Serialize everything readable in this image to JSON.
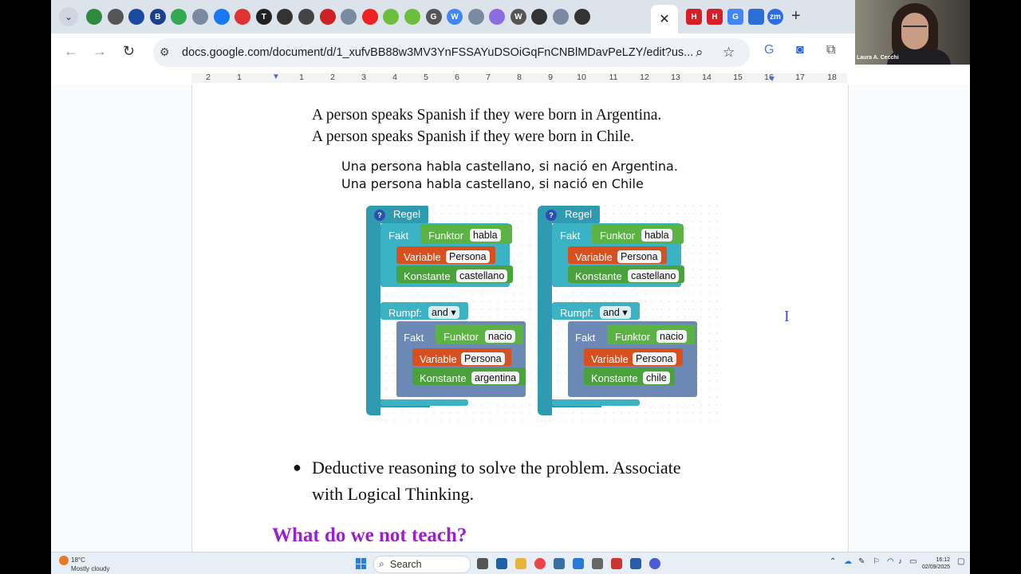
{
  "browser": {
    "tab_strip": {
      "dropdown_icon": "chevron-down-icon",
      "favicon_badges": [
        "",
        "",
        "",
        "B",
        "",
        "",
        "",
        "",
        "T",
        "",
        "",
        "",
        "",
        "",
        "",
        "",
        "G",
        "W",
        "",
        "",
        "W",
        "",
        "",
        ""
      ],
      "active_tab_close": "✕",
      "right_badges": [
        "H",
        "H",
        "G",
        "",
        "zm"
      ],
      "new_tab": "+"
    },
    "toolbar": {
      "back": "←",
      "forward": "→",
      "reload": "↻",
      "url": "docs.google.com/document/d/1_xufvBB88w3MV3YnFSSAYuDSOiGqFnCNBlMDavPeLZY/edit?us..."
    }
  },
  "webcam": {
    "name": "Laura A. Cecchi"
  },
  "ruler": {
    "numbers": [
      "2",
      "1",
      "1",
      "2",
      "3",
      "4",
      "5",
      "6",
      "7",
      "8",
      "9",
      "10",
      "11",
      "12",
      "13",
      "14",
      "15",
      "16",
      "17",
      "18"
    ]
  },
  "doc": {
    "english_lines": [
      "A person speaks Spanish if they were born in Argentina.",
      "A person speaks Spanish if they were born in Chile."
    ],
    "spanish_lines": [
      "Una persona habla castellano, si nació en Argentina.",
      "Una persona habla castellano, si nació en Chile"
    ],
    "bullet_symbol": "●",
    "bullet_lines": [
      "Deductive reasoning to solve the problem. Associate",
      "with Logical Thinking."
    ],
    "heading": "What do we not teach?"
  },
  "blocks": [
    {
      "rule": "Regel",
      "help": "?",
      "head_fakt": "Fakt",
      "head_funktor": "Funktor",
      "head_funktor_value": "habla",
      "variable": "Variable",
      "variable_value": "Persona",
      "konstante": "Konstante",
      "konstante_value": "castellano",
      "rumpf": "Rumpf:",
      "operator": "and",
      "body_fakt": "Fakt",
      "body_funktor": "Funktor",
      "body_funktor_value": "nacio",
      "body_variable": "Variable",
      "body_variable_value": "Persona",
      "body_konstante": "Konstante",
      "body_konstante_value": "argentina"
    },
    {
      "rule": "Regel",
      "help": "?",
      "head_fakt": "Fakt",
      "head_funktor": "Funktor",
      "head_funktor_value": "habla",
      "variable": "Variable",
      "variable_value": "Persona",
      "konstante": "Konstante",
      "konstante_value": "castellano",
      "rumpf": "Rumpf:",
      "operator": "and",
      "body_fakt": "Fakt",
      "body_funktor": "Funktor",
      "body_funktor_value": "nacio",
      "body_variable": "Variable",
      "body_variable_value": "Persona",
      "body_konstante": "Konstante",
      "body_konstante_value": "chile"
    }
  ],
  "taskbar": {
    "weather_temp": "18°C",
    "weather_desc": "Mostly cloudy",
    "search_label": "Search",
    "time": "16:12",
    "date": "02/09/2025"
  }
}
